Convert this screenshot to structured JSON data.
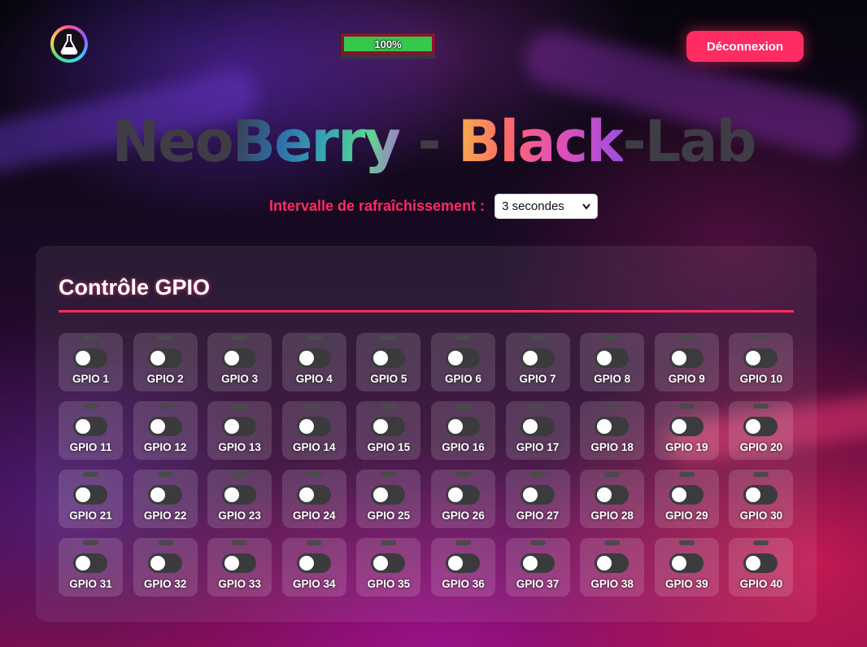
{
  "header": {
    "logo_icon": "flask-icon",
    "battery": {
      "label": "100%",
      "level": 1.0,
      "fill_color": "#35c84a"
    },
    "logout_label": "Déconnexion"
  },
  "title": {
    "part1": "Neo",
    "part2": "Berry",
    "part3": " - ",
    "part4": "Black",
    "part5": "-Lab"
  },
  "refresh": {
    "label": "Intervalle de rafraîchissement :",
    "selected": "3 secondes"
  },
  "panel": {
    "title": "Contrôle GPIO",
    "gpios": [
      {
        "label": "GPIO 1",
        "on": false
      },
      {
        "label": "GPIO 2",
        "on": false
      },
      {
        "label": "GPIO 3",
        "on": false
      },
      {
        "label": "GPIO 4",
        "on": false
      },
      {
        "label": "GPIO 5",
        "on": false
      },
      {
        "label": "GPIO 6",
        "on": false
      },
      {
        "label": "GPIO 7",
        "on": false
      },
      {
        "label": "GPIO 8",
        "on": false
      },
      {
        "label": "GPIO 9",
        "on": false
      },
      {
        "label": "GPIO 10",
        "on": false
      },
      {
        "label": "GPIO 11",
        "on": false
      },
      {
        "label": "GPIO 12",
        "on": false
      },
      {
        "label": "GPIO 13",
        "on": false
      },
      {
        "label": "GPIO 14",
        "on": false
      },
      {
        "label": "GPIO 15",
        "on": false
      },
      {
        "label": "GPIO 16",
        "on": false
      },
      {
        "label": "GPIO 17",
        "on": false
      },
      {
        "label": "GPIO 18",
        "on": false
      },
      {
        "label": "GPIO 19",
        "on": false
      },
      {
        "label": "GPIO 20",
        "on": false
      },
      {
        "label": "GPIO 21",
        "on": false
      },
      {
        "label": "GPIO 22",
        "on": false
      },
      {
        "label": "GPIO 23",
        "on": false
      },
      {
        "label": "GPIO 24",
        "on": false
      },
      {
        "label": "GPIO 25",
        "on": false
      },
      {
        "label": "GPIO 26",
        "on": false
      },
      {
        "label": "GPIO 27",
        "on": false
      },
      {
        "label": "GPIO 28",
        "on": false
      },
      {
        "label": "GPIO 29",
        "on": false
      },
      {
        "label": "GPIO 30",
        "on": false
      },
      {
        "label": "GPIO 31",
        "on": false
      },
      {
        "label": "GPIO 32",
        "on": false
      },
      {
        "label": "GPIO 33",
        "on": false
      },
      {
        "label": "GPIO 34",
        "on": false
      },
      {
        "label": "GPIO 35",
        "on": false
      },
      {
        "label": "GPIO 36",
        "on": false
      },
      {
        "label": "GPIO 37",
        "on": false
      },
      {
        "label": "GPIO 38",
        "on": false
      },
      {
        "label": "GPIO 39",
        "on": false
      },
      {
        "label": "GPIO 40",
        "on": false
      }
    ]
  },
  "colors": {
    "accent": "#ff2c63",
    "toggle_off": "#3b3b3d",
    "led_off": "#4a4a4a"
  }
}
